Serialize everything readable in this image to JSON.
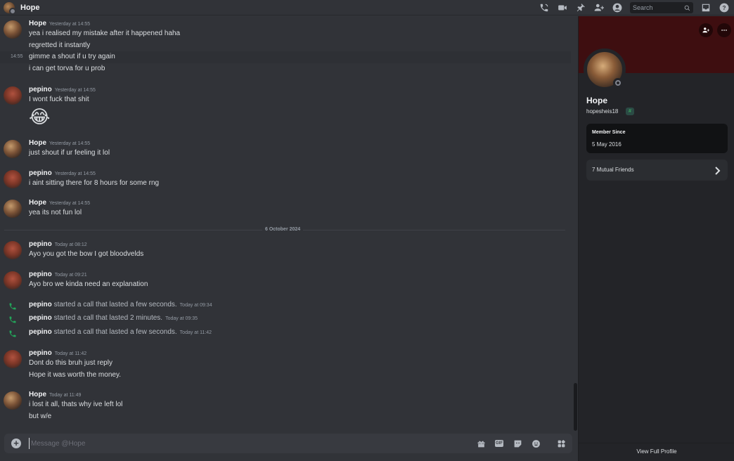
{
  "header": {
    "title": "Hope",
    "search_placeholder": "Search",
    "icons": [
      "voice-call-icon",
      "video-call-icon",
      "pin-icon",
      "add-friends-icon",
      "user-profile-icon",
      "inbox-icon",
      "help-icon"
    ]
  },
  "messages": [
    {
      "author": "Hope",
      "timestamp": "Yesterday at 14:55",
      "lines": [
        "yea i realised my mistake after it happened haha",
        "regretted it instantly"
      ]
    },
    {
      "hover_time": "14:55",
      "lines": [
        "gimme a shout if u try again",
        "i can get torva for u prob"
      ]
    },
    {
      "author": "pepino",
      "timestamp": "Yesterday at 14:55",
      "lines": [
        "I wont fuck that shit"
      ],
      "emoji": "😂"
    },
    {
      "author": "Hope",
      "timestamp": "Yesterday at 14:55",
      "lines": [
        "just shout if ur feeling it lol"
      ]
    },
    {
      "author": "pepino",
      "timestamp": "Yesterday at 14:55",
      "lines": [
        "i aint sitting there for 8 hours for some rng"
      ]
    },
    {
      "author": "Hope",
      "timestamp": "Yesterday at 14:55",
      "lines": [
        "yea its not fun lol"
      ]
    },
    {
      "divider": "6 October 2024"
    },
    {
      "author": "pepino",
      "timestamp": "Today at 08:12",
      "lines": [
        "Ayo you got the bow I got bloodvelds"
      ]
    },
    {
      "author": "pepino",
      "timestamp": "Today at 09:21",
      "lines": [
        "Ayo bro we kinda need an explanation"
      ]
    },
    {
      "call_author": "pepino",
      "call_text": "started a call that lasted a few seconds.",
      "timestamp": "Today at 09:34"
    },
    {
      "call_author": "pepino",
      "call_text": "started a call that lasted 2 minutes.",
      "timestamp": "Today at 09:35"
    },
    {
      "call_author": "pepino",
      "call_text": "started a call that lasted a few seconds.",
      "timestamp": "Today at 11:42"
    },
    {
      "author": "pepino",
      "timestamp": "Today at 11:42",
      "lines": [
        "Dont do this bruh just reply",
        "Hope it was worth the money."
      ]
    },
    {
      "author": "Hope",
      "timestamp": "Today at 11:49",
      "lines": [
        "i lost it all, thats why ive left lol",
        "but w/e"
      ]
    }
  ],
  "composer": {
    "placeholder": "Message @Hope",
    "gif_label": "GIF"
  },
  "profile": {
    "display_name": "Hope",
    "username": "hopesheis18",
    "badge": "#",
    "member_since_label": "Member Since",
    "member_since_value": "5 May 2016",
    "mutual_friends": "7 Mutual Friends",
    "view_full_profile": "View Full Profile",
    "banner_color": "#3e0e10"
  },
  "colors": {
    "background": "#313338",
    "panel": "#232428",
    "call_green": "#23a55a"
  }
}
